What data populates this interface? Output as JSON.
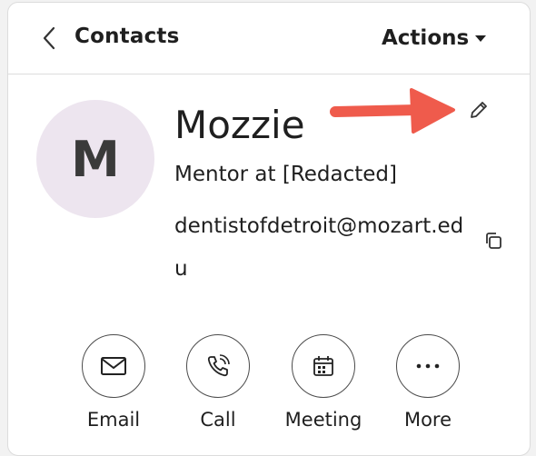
{
  "header": {
    "title": "Contacts",
    "actions_label": "Actions",
    "back_icon": "chevron-left-icon",
    "actions_caret_icon": "caret-down-icon"
  },
  "contact": {
    "initial": "M",
    "name": "Mozzie",
    "subtitle": "Mentor at [Redacted]",
    "email": "dentistofdetroit@mozart.edu",
    "avatar_bg": "#ede5ef"
  },
  "icons": {
    "edit": "pencil-icon",
    "copy": "copy-icon",
    "annotation": "red-arrow-icon"
  },
  "colors": {
    "annotation_arrow": "#ef5b4c",
    "border": "#dcdcdc"
  },
  "quick_actions": [
    {
      "label": "Email",
      "icon": "envelope-icon"
    },
    {
      "label": "Call",
      "icon": "phone-icon"
    },
    {
      "label": "Meeting",
      "icon": "calendar-icon"
    },
    {
      "label": "More",
      "icon": "ellipsis-icon"
    }
  ]
}
